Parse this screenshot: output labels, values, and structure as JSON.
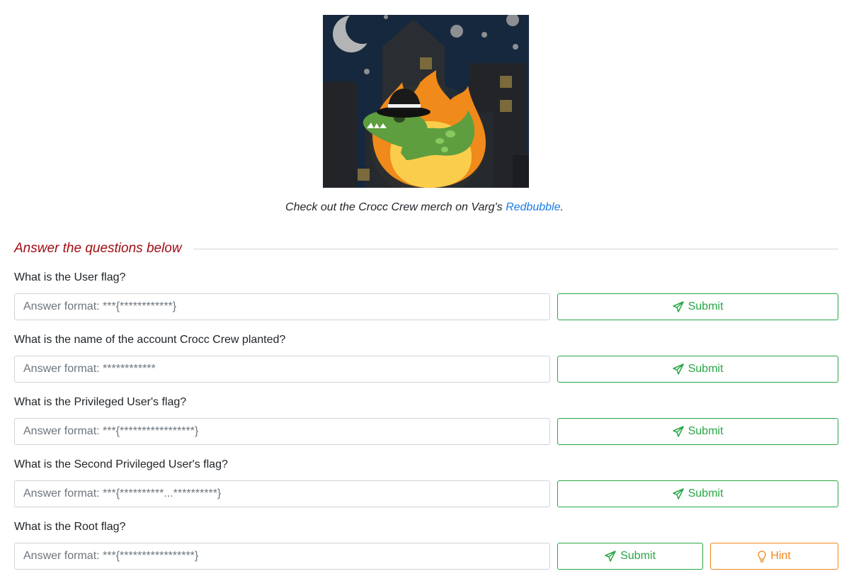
{
  "caption": {
    "prefix": "Check out the Crocc Crew merch on Varg's ",
    "link_text": "Redbubble",
    "suffix": "."
  },
  "section": {
    "title": "Answer the questions below"
  },
  "questions": [
    {
      "label": "What is the User flag?",
      "placeholder": "Answer format: ***{************}",
      "submit_label": "Submit"
    },
    {
      "label": "What is the name of the account Crocc Crew planted?",
      "placeholder": "Answer format: ************",
      "submit_label": "Submit"
    },
    {
      "label": "What is the Privileged User's flag?",
      "placeholder": "Answer format: ***{*****************}",
      "submit_label": "Submit"
    },
    {
      "label": "What is the Second Privileged User's flag?",
      "placeholder": "Answer format: ***{**********...**********}",
      "submit_label": "Submit"
    },
    {
      "label": "What is the Root flag?",
      "placeholder": "Answer format: ***{*****************}",
      "submit_label": "Submit",
      "hint_label": "Hint"
    }
  ],
  "colors": {
    "heading": "#a10d12",
    "link": "#1a7ce8",
    "submit": "#28a745",
    "hint": "#f0861c"
  },
  "icons": {
    "submit": "paper-plane-icon",
    "hint": "lightbulb-icon"
  }
}
